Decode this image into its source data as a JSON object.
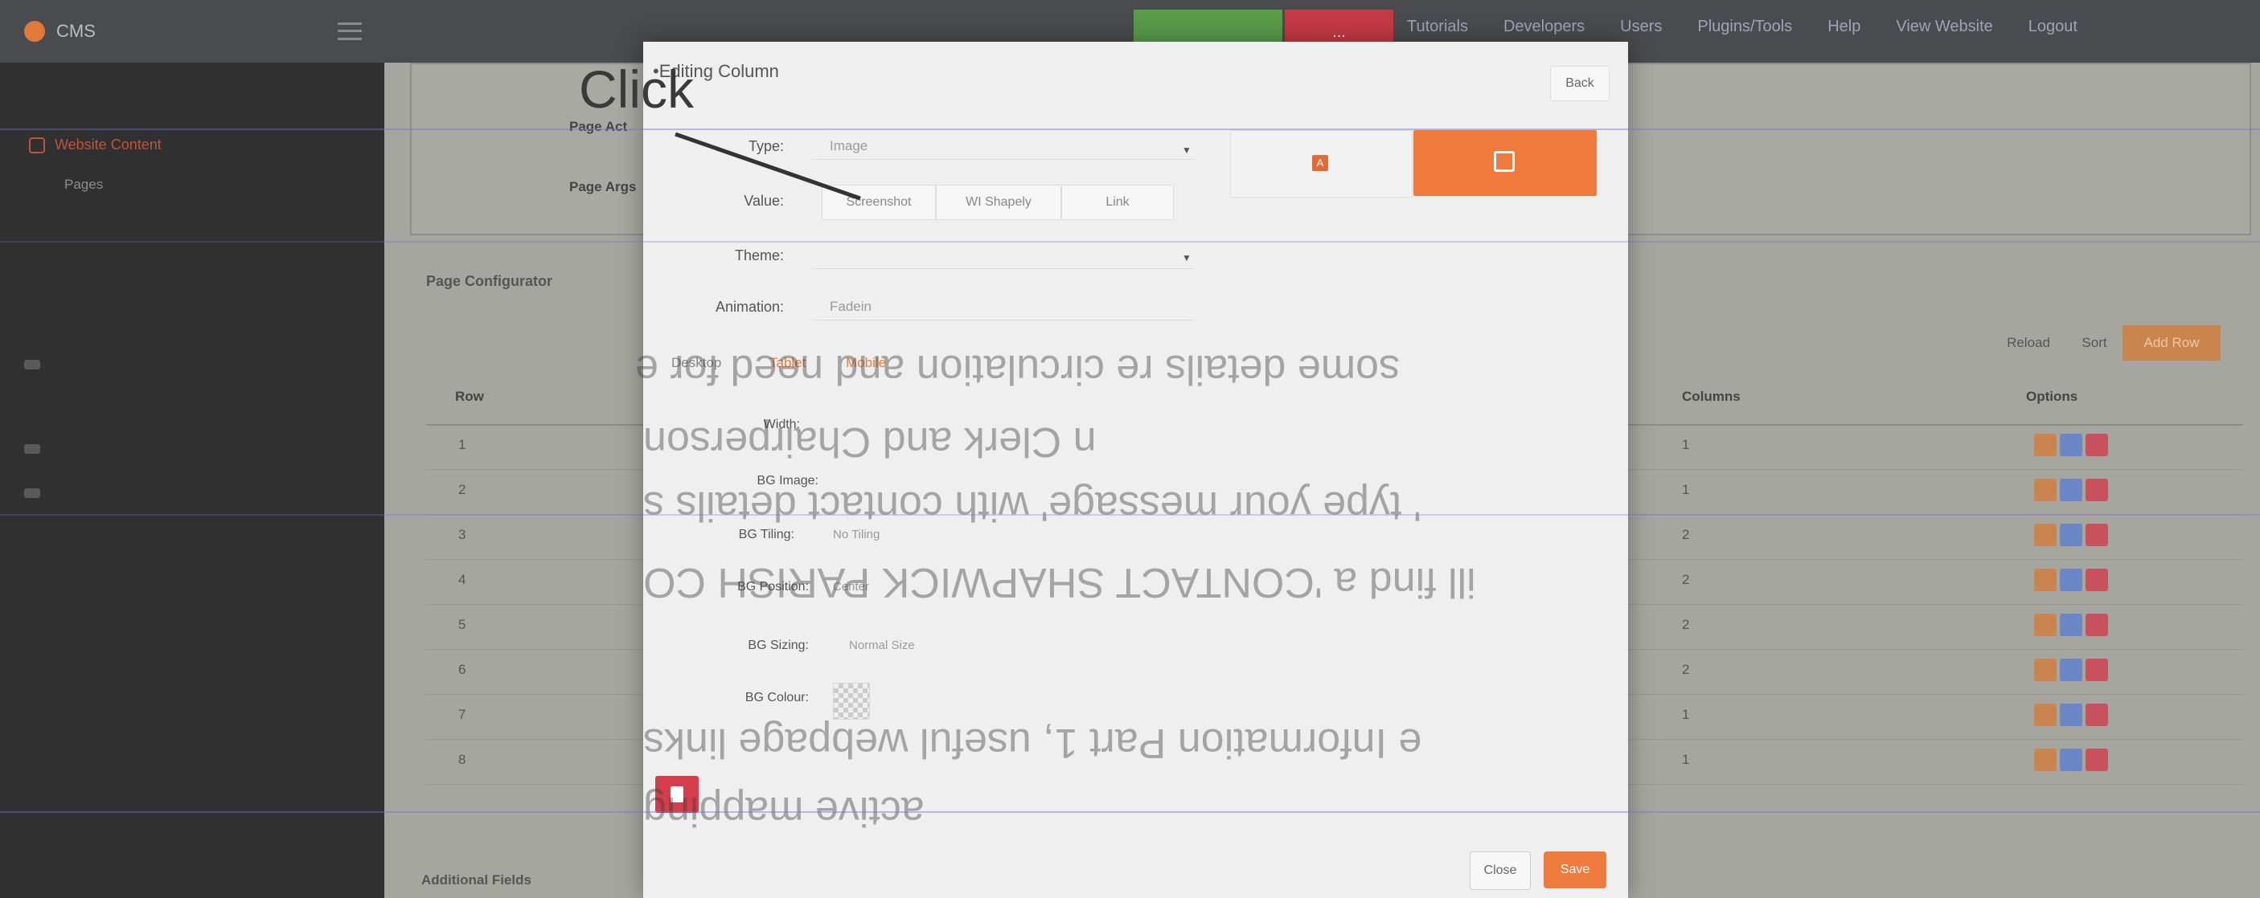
{
  "topbar": {
    "logo_text": "CMS",
    "red_label": "...",
    "links": [
      "Tutorials",
      "Developers",
      "Users",
      "Plugins/Tools",
      "Help",
      "View Website",
      "Logout"
    ]
  },
  "sidebar": {
    "active_item": "Website Content",
    "sub_item": "Pages"
  },
  "page": {
    "page_label_1": "Page Act",
    "page_label_2": "Page Args",
    "configurator_title": "Page Configurator",
    "reload_label": "Reload",
    "sort_label": "Sort",
    "add_row_label": "Add Row",
    "additional_fields": "Additional Fields",
    "table": {
      "headers": [
        "Row",
        "Columns",
        "Options"
      ],
      "rows": [
        {
          "row": "1",
          "columns": "1"
        },
        {
          "row": "2",
          "columns": "1"
        },
        {
          "row": "3",
          "columns": "2"
        },
        {
          "row": "4",
          "columns": "2"
        },
        {
          "row": "5",
          "columns": "2"
        },
        {
          "row": "6",
          "columns": "2"
        },
        {
          "row": "7",
          "columns": "1"
        },
        {
          "row": "8",
          "columns": "1"
        }
      ]
    }
  },
  "modal": {
    "title": "Editing Column",
    "back_label": "Back",
    "click_annotation": "Click",
    "fields": {
      "type_label": "Type:",
      "type_value": "Image",
      "value_label": "Value:",
      "value_segments": [
        "Screenshot",
        "WI Shapely",
        "Link"
      ],
      "theme_label": "Theme:",
      "theme_value": "",
      "animation_label": "Animation:",
      "animation_value": "Fadein",
      "devices": [
        "Desktop",
        "Tablet",
        "Mobile"
      ],
      "width_label": "Width:",
      "bg_image_label": "BG Image:",
      "bg_tiling_label": "BG Tiling:",
      "bg_tiling_value": "No Tiling",
      "bg_position_label": "BG Position:",
      "bg_position_value": "Center",
      "bg_sizing_label": "BG Sizing:",
      "bg_sizing_value": "Normal Size",
      "bg_colour_label": "BG Colour:"
    },
    "close_label": "Close",
    "save_label": "Save"
  },
  "bleed_through_text": [
    "some details re circulation and need for e",
    "n Clerk and Chairperson",
    "' type your message' with contact details s",
    "ill find a 'CONTACT SHAPWICK PARISH CO",
    "e Information Part 1, useful webpage links",
    "active mapping"
  ],
  "colors": {
    "accent_orange": "#ee7a3e",
    "danger_red": "#d43e4a",
    "success_green": "#5cb04a",
    "primary_blue": "#4a74c9"
  }
}
